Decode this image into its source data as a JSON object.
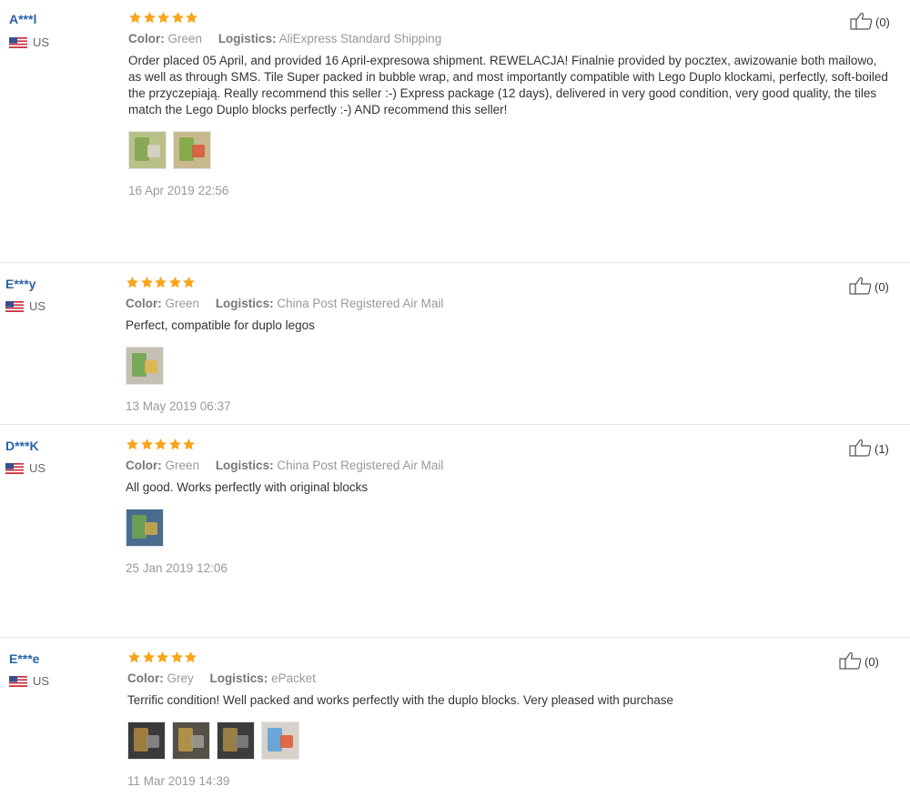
{
  "reviews": [
    {
      "user": "A***l",
      "country": "US",
      "color_label": "Color:",
      "color": "Green",
      "logistics_label": "Logistics:",
      "logistics": "AliExpress Standard Shipping",
      "text": "Order placed 05 April, and provided 16 April-expresowa shipment. REWELACJA! Finalnie provided by pocztex, awizowanie both mailowo, as well as through SMS. Tile Super packed in bubble wrap, and most importantly compatible with Lego Duplo klockami, perfectly, soft-boiled the przyczepiają. Really recommend this seller :-) Express package (12 days), delivered in very good condition, very good quality, the tiles match the Lego Duplo blocks perfectly :-) AND recommend this seller!",
      "date": "16 Apr 2019 22:56",
      "likes": "(0)",
      "rating": 5,
      "photo_count": 2
    },
    {
      "user": "E***y",
      "country": "US",
      "color_label": "Color:",
      "color": "Green",
      "logistics_label": "Logistics:",
      "logistics": "China Post Registered Air Mail",
      "text": "Perfect, compatible for duplo legos",
      "date": "13 May 2019 06:37",
      "likes": "(0)",
      "rating": 5,
      "photo_count": 1
    },
    {
      "user": "D***K",
      "country": "US",
      "color_label": "Color:",
      "color": "Green",
      "logistics_label": "Logistics:",
      "logistics": "China Post Registered Air Mail",
      "text": "All good. Works perfectly with original blocks",
      "date": "25 Jan 2019 12:06",
      "likes": "(1)",
      "rating": 5,
      "photo_count": 1
    },
    {
      "user": "E***e",
      "country": "US",
      "color_label": "Color:",
      "color": "Grey",
      "logistics_label": "Logistics:",
      "logistics": "ePacket",
      "text": "Terrific condition! Well packed and works perfectly with the duplo blocks. Very pleased with purchase",
      "date": "11 Mar 2019 14:39",
      "likes": "(0)",
      "rating": 5,
      "photo_count": 4
    }
  ],
  "icons": {
    "star": "star-icon",
    "thumb": "thumbs-up-icon",
    "flag": "us-flag-icon"
  },
  "colors": {
    "star": "#f8a51c",
    "username": "#2a63a7",
    "muted": "#999999",
    "divider": "#e8e8e8"
  }
}
